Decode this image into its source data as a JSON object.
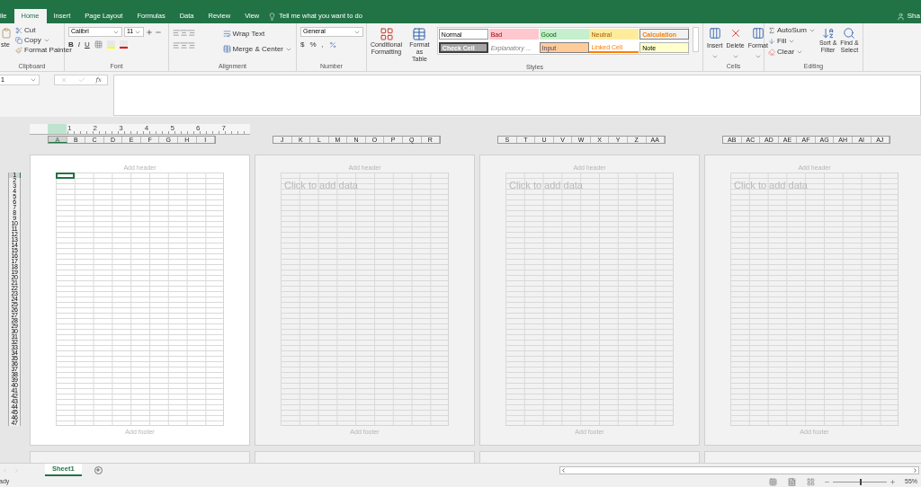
{
  "tabs": [
    {
      "label": "ile",
      "selected": false
    },
    {
      "label": "Home",
      "selected": true
    },
    {
      "label": "Insert",
      "selected": false
    },
    {
      "label": "Page Layout",
      "selected": false
    },
    {
      "label": "Formulas",
      "selected": false
    },
    {
      "label": "Data",
      "selected": false
    },
    {
      "label": "Review",
      "selected": false
    },
    {
      "label": "View",
      "selected": false
    }
  ],
  "tell_me": "Tell me what you want to do",
  "account": "Sha",
  "clipboard": {
    "paste": "ste",
    "cut": "Cut",
    "copy": "Copy",
    "format_painter": "Format Painter",
    "label": "Clipboard"
  },
  "font": {
    "name": "Calibri",
    "size": "11",
    "bold": "B",
    "italic": "I",
    "underline": "U",
    "label": "Font"
  },
  "alignment": {
    "wrap": "Wrap Text",
    "merge": "Merge & Center",
    "label": "Alignment"
  },
  "number": {
    "format": "General",
    "currency": "$",
    "percent": "%",
    "comma": ",",
    "label": "Number"
  },
  "styles": {
    "conditional": [
      "Conditional",
      "Formatting"
    ],
    "format_table": [
      "Format as",
      "Table"
    ],
    "cells": [
      {
        "label": "Normal",
        "kind": "normal"
      },
      {
        "label": "Bad",
        "kind": "bad"
      },
      {
        "label": "Good",
        "kind": "good"
      },
      {
        "label": "Neutral",
        "kind": "neutral"
      },
      {
        "label": "Calculation",
        "kind": "calculation"
      },
      {
        "label": "Check Cell",
        "kind": "check"
      },
      {
        "label": "Explanatory ...",
        "kind": "explanatory"
      },
      {
        "label": "Input",
        "kind": "input"
      },
      {
        "label": "Linked Cell",
        "kind": "linked"
      },
      {
        "label": "Note",
        "kind": "note"
      }
    ],
    "label": "Styles"
  },
  "cells": {
    "buttons": [
      "Insert",
      "Delete",
      "Format"
    ],
    "label": "Cells"
  },
  "editing": {
    "autosum": "AutoSum",
    "fill": "Fill",
    "clear": "Clear",
    "sort": [
      "Sort &",
      "Filter"
    ],
    "find": [
      "Find &",
      "Select"
    ],
    "label": "Editing"
  },
  "name_box": "1",
  "function_label": "fx",
  "ruler": [
    "1",
    "2",
    "3",
    "4",
    "5",
    "6",
    "7"
  ],
  "row_headers": [
    "1",
    "2",
    "3",
    "4",
    "5",
    "6",
    "7",
    "8",
    "9",
    "10",
    "11",
    "12",
    "13",
    "14",
    "15",
    "16",
    "17",
    "18",
    "19",
    "20",
    "21",
    "22",
    "23",
    "24",
    "25",
    "26",
    "27",
    "28",
    "29",
    "30",
    "31",
    "32",
    "33",
    "34",
    "35",
    "36",
    "37",
    "38",
    "39",
    "40",
    "41",
    "42",
    "43",
    "44",
    "45",
    "46",
    "47"
  ],
  "pages": [
    {
      "selected": true,
      "header": "Add header",
      "footer": "Add footer",
      "columns": [
        "A",
        "B",
        "C",
        "D",
        "E",
        "F",
        "G",
        "H",
        "I"
      ]
    },
    {
      "selected": false,
      "header": "Add header",
      "prompt": "Click to add data",
      "footer": "Add footer",
      "columns": [
        "J",
        "K",
        "L",
        "M",
        "N",
        "O",
        "P",
        "Q",
        "R"
      ]
    },
    {
      "selected": false,
      "header": "Add header",
      "prompt": "Click to add data",
      "footer": "Add footer",
      "columns": [
        "S",
        "T",
        "U",
        "V",
        "W",
        "X",
        "Y",
        "Z",
        "AA"
      ]
    },
    {
      "selected": false,
      "header": "Add header",
      "prompt": "Click to add data",
      "footer": "Add footer",
      "columns": [
        "AB",
        "AC",
        "AD",
        "AE",
        "AF",
        "AG",
        "AH",
        "AI",
        "AJ"
      ]
    }
  ],
  "sheets": [
    {
      "label": "Sheet1",
      "selected": true
    }
  ],
  "status": "ady",
  "zoom": {
    "level": 0.5,
    "reading": "55%"
  }
}
